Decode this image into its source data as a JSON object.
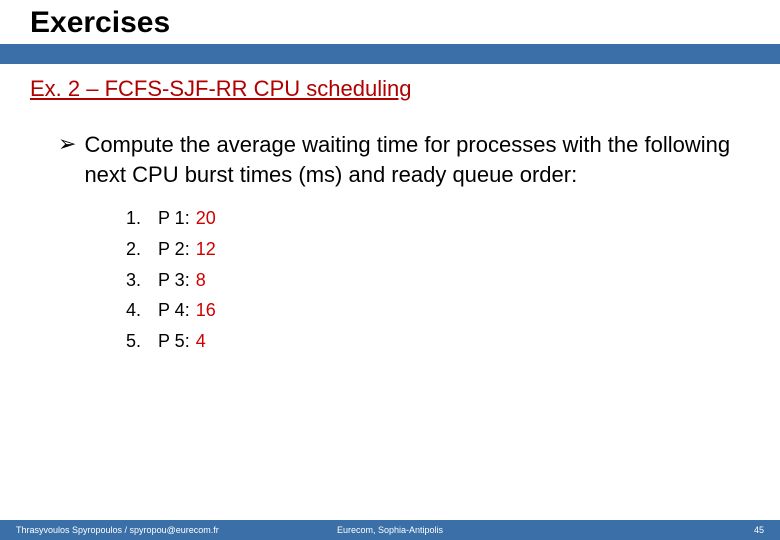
{
  "title": "Exercises",
  "subtitle": "Ex. 2 – FCFS-SJF-RR CPU scheduling",
  "bullet_glyph": "➢",
  "bullet_text": "Compute the average waiting time for processes with the following next CPU burst times (ms) and ready queue order:",
  "processes": [
    {
      "n": "1.",
      "label": "P 1:",
      "value": "20"
    },
    {
      "n": "2.",
      "label": "P 2:",
      "value": "12"
    },
    {
      "n": "3.",
      "label": "P 3:",
      "value": "8"
    },
    {
      "n": "4.",
      "label": "P 4:",
      "value": "16"
    },
    {
      "n": "5.",
      "label": "P 5:",
      "value": "4"
    }
  ],
  "footer": {
    "left": "Thrasyvoulos Spyropoulos / spyropou@eurecom.fr",
    "center": "Eurecom, Sophia-Antipolis",
    "right": "45"
  }
}
